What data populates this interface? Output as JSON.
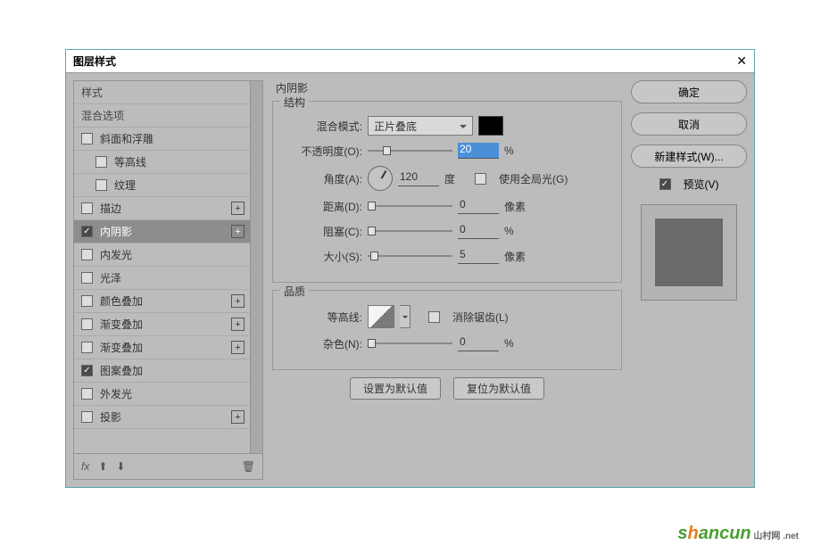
{
  "title": "图层样式",
  "sidebar": {
    "header_styles": "样式",
    "header_blend": "混合选项",
    "items": [
      {
        "label": "斜面和浮雕",
        "checked": false,
        "indent": false,
        "plus": false
      },
      {
        "label": "等高线",
        "checked": false,
        "indent": true,
        "plus": false
      },
      {
        "label": "纹理",
        "checked": false,
        "indent": true,
        "plus": false
      },
      {
        "label": "描边",
        "checked": false,
        "indent": false,
        "plus": true
      },
      {
        "label": "内阴影",
        "checked": true,
        "indent": false,
        "plus": true,
        "selected": true
      },
      {
        "label": "内发光",
        "checked": false,
        "indent": false,
        "plus": false
      },
      {
        "label": "光泽",
        "checked": false,
        "indent": false,
        "plus": false
      },
      {
        "label": "颜色叠加",
        "checked": false,
        "indent": false,
        "plus": true
      },
      {
        "label": "渐变叠加",
        "checked": false,
        "indent": false,
        "plus": true
      },
      {
        "label": "渐变叠加",
        "checked": false,
        "indent": false,
        "plus": true
      },
      {
        "label": "图案叠加",
        "checked": true,
        "indent": false,
        "plus": false
      },
      {
        "label": "外发光",
        "checked": false,
        "indent": false,
        "plus": false
      },
      {
        "label": "投影",
        "checked": false,
        "indent": false,
        "plus": true
      }
    ],
    "foot_fx": "fx"
  },
  "panel": {
    "title": "内阴影",
    "structure": {
      "legend": "结构",
      "blend_label": "混合模式:",
      "blend_value": "正片叠底",
      "opacity_label": "不透明度(O):",
      "opacity_value": "20",
      "opacity_unit": "%",
      "angle_label": "角度(A):",
      "angle_value": "120",
      "angle_unit": "度",
      "global_label": "使用全局光(G)",
      "distance_label": "距离(D):",
      "distance_value": "0",
      "distance_unit": "像素",
      "choke_label": "阻塞(C):",
      "choke_value": "0",
      "choke_unit": "%",
      "size_label": "大小(S):",
      "size_value": "5",
      "size_unit": "像素"
    },
    "quality": {
      "legend": "品质",
      "contour_label": "等高线:",
      "antialias_label": "消除锯齿(L)",
      "noise_label": "杂色(N):",
      "noise_value": "0",
      "noise_unit": "%"
    },
    "btn_default": "设置为默认值",
    "btn_reset": "复位为默认值"
  },
  "right": {
    "ok": "确定",
    "cancel": "取消",
    "newstyle": "新建样式(W)...",
    "preview": "预览(V)"
  },
  "colors": {
    "swatch": "#000000"
  }
}
